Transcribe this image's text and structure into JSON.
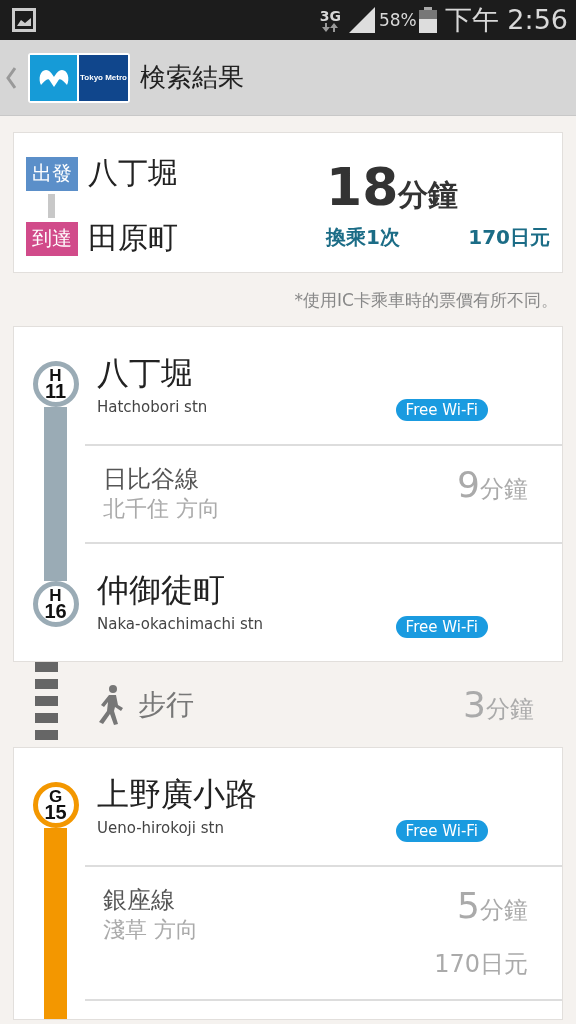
{
  "status_bar": {
    "network": "3G",
    "battery": "58%",
    "time": "下午 2:56"
  },
  "header": {
    "logo_text": "Tokyo Metro",
    "title": "検索結果"
  },
  "summary": {
    "departure_label": "出發",
    "departure": "八丁堀",
    "arrival_label": "到達",
    "arrival": "田原町",
    "duration": "18",
    "duration_unit": "分鐘",
    "transfers": "換乘1次",
    "fare": "170日元"
  },
  "note": "*使用IC卡乘車時的票價有所不同。",
  "legs": [
    {
      "kind": "ride",
      "color": "#9aabb5",
      "from": {
        "code_letter": "H",
        "code_number": "11",
        "name": "八丁堀",
        "romaji": "Hatchobori stn",
        "wifi": "Free Wi-Fi"
      },
      "line": {
        "name": "日比谷線",
        "direction": "北千住 方向",
        "minutes": "9",
        "unit": "分鐘"
      },
      "to": {
        "code_letter": "H",
        "code_number": "16",
        "name": "仲御徒町",
        "romaji": "Naka-okachimachi stn",
        "wifi": "Free Wi-Fi"
      }
    },
    {
      "kind": "walk",
      "label": "步行",
      "minutes": "3",
      "unit": "分鐘"
    },
    {
      "kind": "ride",
      "color": "#f39700",
      "from": {
        "code_letter": "G",
        "code_number": "15",
        "name": "上野廣小路",
        "romaji": "Ueno-hirokoji stn",
        "wifi": "Free Wi-Fi"
      },
      "line": {
        "name": "銀座線",
        "direction": "淺草 方向",
        "minutes": "5",
        "unit": "分鐘",
        "fare": "170日元"
      }
    }
  ]
}
